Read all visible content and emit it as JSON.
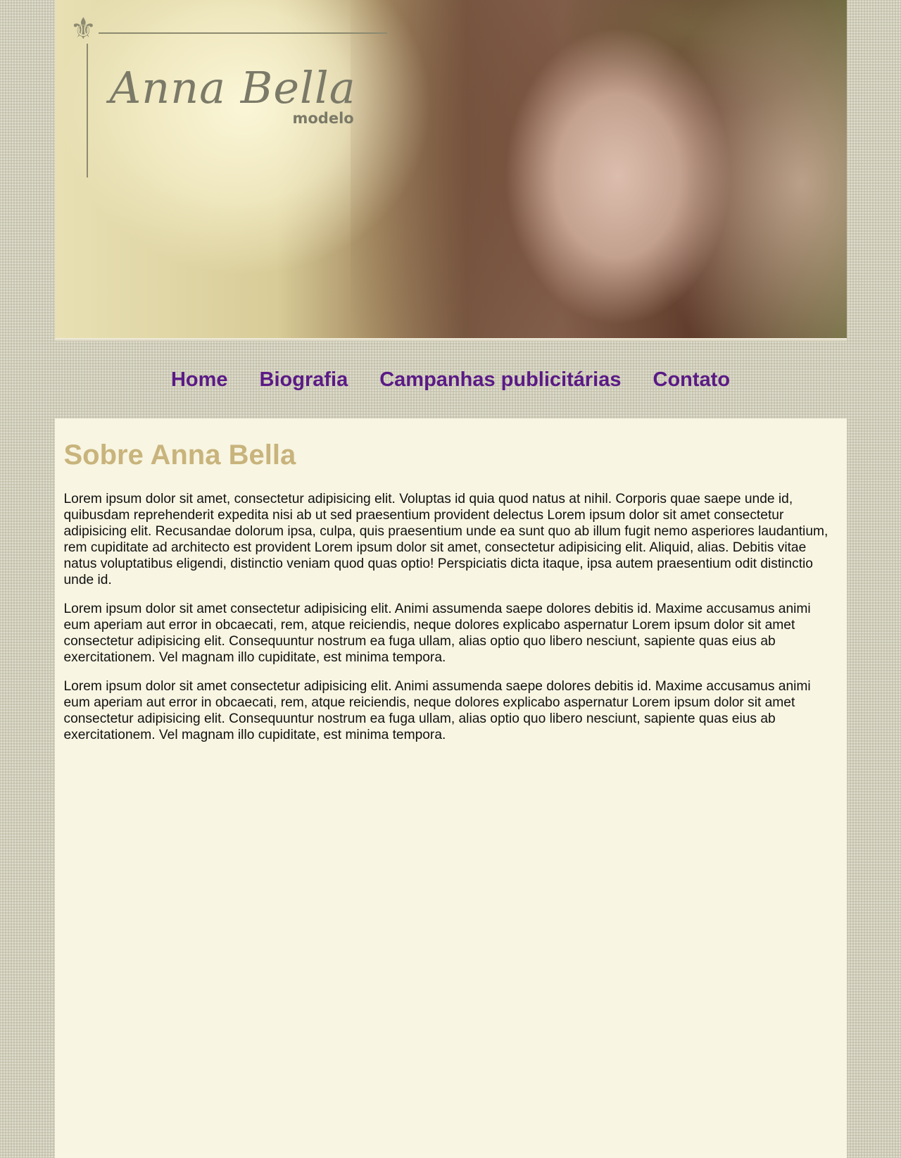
{
  "header": {
    "logo_name": "Anna Bella",
    "logo_sub": "modelo"
  },
  "nav": {
    "items": [
      {
        "label": "Home"
      },
      {
        "label": "Biografia"
      },
      {
        "label": "Campanhas publicitárias"
      },
      {
        "label": "Contato"
      }
    ]
  },
  "main": {
    "title": "Sobre Anna Bella",
    "paragraphs": [
      "Lorem ipsum dolor sit amet, consectetur adipisicing elit. Voluptas id quia quod natus at nihil. Corporis quae saepe unde id, quibusdam reprehenderit expedita nisi ab ut sed praesentium provident delectus Lorem ipsum dolor sit amet consectetur adipisicing elit. Recusandae dolorum ipsa, culpa, quis praesentium unde ea sunt quo ab illum fugit nemo asperiores laudantium, rem cupiditate ad architecto est provident Lorem ipsum dolor sit amet, consectetur adipisicing elit. Aliquid, alias. Debitis vitae natus voluptatibus eligendi, distinctio veniam quod quas optio! Perspiciatis dicta itaque, ipsa autem praesentium odit distinctio unde id.",
      "Lorem ipsum dolor sit amet consectetur adipisicing elit. Animi assumenda saepe dolores debitis id. Maxime accusamus animi eum aperiam aut error in obcaecati, rem, atque reiciendis, neque dolores explicabo aspernatur Lorem ipsum dolor sit amet consectetur adipisicing elit. Consequuntur nostrum ea fuga ullam, alias optio quo libero nesciunt, sapiente quas eius ab exercitationem. Vel magnam illo cupiditate, est minima tempora.",
      "Lorem ipsum dolor sit amet consectetur adipisicing elit. Animi assumenda saepe dolores debitis id. Maxime accusamus animi eum aperiam aut error in obcaecati, rem, atque reiciendis, neque dolores explicabo aspernatur Lorem ipsum dolor sit amet consectetur adipisicing elit. Consequuntur nostrum ea fuga ullam, alias optio quo libero nesciunt, sapiente quas eius ab exercitationem. Vel magnam illo cupiditate, est minima tempora."
    ]
  },
  "colors": {
    "nav_link": "#5b1a86",
    "heading": "#c8b47c",
    "content_bg": "#f8f5e2",
    "page_bg": "#cfcdb8"
  }
}
